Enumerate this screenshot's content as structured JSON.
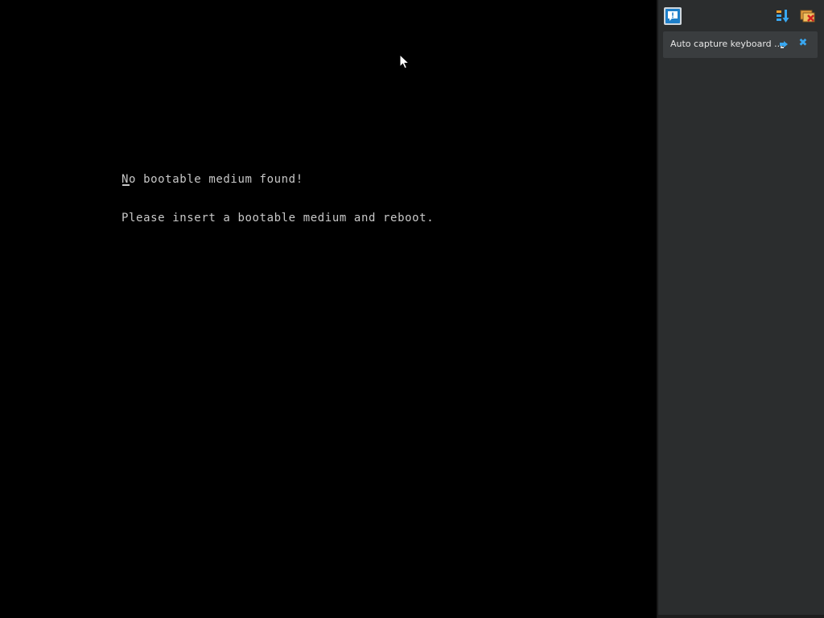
{
  "vm_console": {
    "lines": [
      "No bootable medium found!",
      "Please insert a bootable medium and reboot."
    ],
    "cursor_char": "_"
  },
  "notification_panel": {
    "buttons": {
      "info_icon": "info-message-icon",
      "sort_icon": "sort-notifications-icon",
      "clear_icon": "clear-all-notifications-icon"
    },
    "notifications": [
      {
        "text": "Auto capture keyboard ...",
        "pin_icon": "pin-icon",
        "close_icon": "close-icon",
        "close_glyph": "✖"
      }
    ]
  },
  "colors": {
    "screen_bg": "#000000",
    "console_text": "#c8c8c8",
    "panel_bg": "#2b2d2e",
    "notification_bg": "#3a3d3f",
    "accent_blue": "#39a7f0"
  }
}
